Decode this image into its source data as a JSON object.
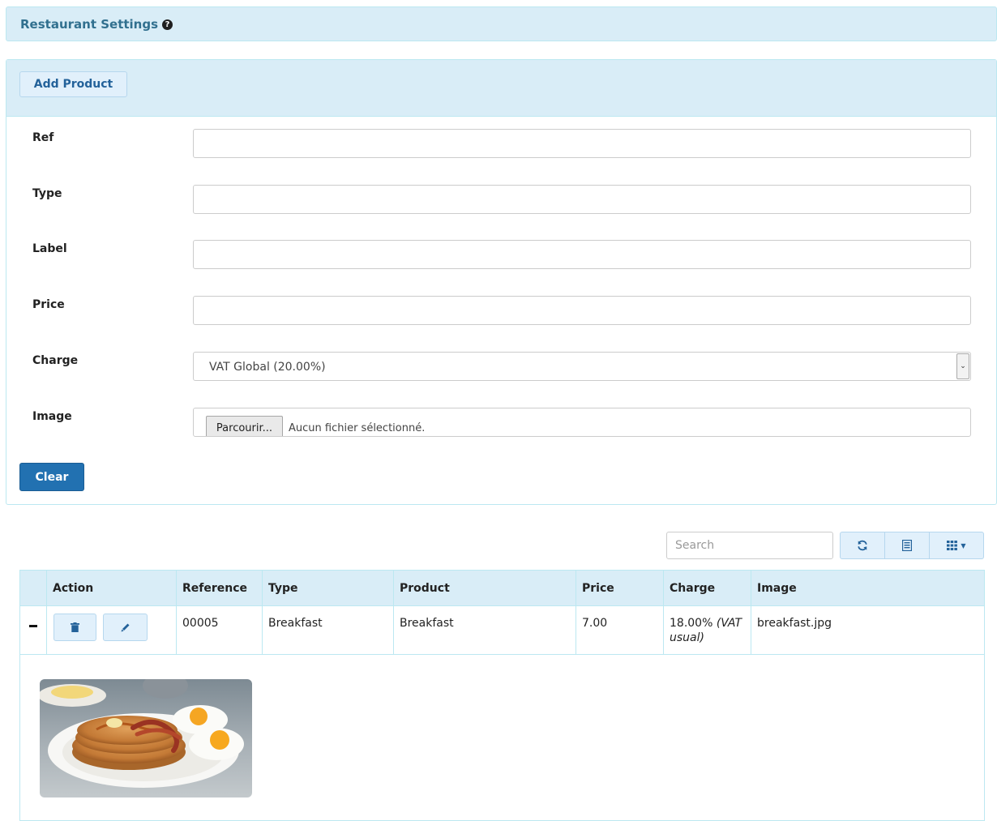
{
  "header": {
    "title": "Restaurant Settings"
  },
  "form": {
    "add_button": "Add Product",
    "fields": {
      "ref": {
        "label": "Ref",
        "value": ""
      },
      "type": {
        "label": "Type",
        "value": ""
      },
      "label": {
        "label": "Label",
        "value": ""
      },
      "price": {
        "label": "Price",
        "value": ""
      },
      "charge": {
        "label": "Charge",
        "selected": "VAT Global (20.00%)"
      },
      "image": {
        "label": "Image",
        "browse_button": "Parcourir...",
        "status": "Aucun fichier sélectionné."
      }
    },
    "clear_button": "Clear"
  },
  "toolbar": {
    "search_placeholder": "Search",
    "icons": [
      "refresh-icon",
      "list-icon",
      "columns-icon"
    ]
  },
  "table": {
    "columns": [
      "Action",
      "Reference",
      "Type",
      "Product",
      "Price",
      "Charge",
      "Image"
    ],
    "rows": [
      {
        "reference": "00005",
        "type": "Breakfast",
        "product": "Breakfast",
        "price": "7.00",
        "charge_rate": "18.00%",
        "charge_name": "(VAT usual)",
        "image": "breakfast.jpg"
      }
    ]
  },
  "colors": {
    "accent": "#d9edf7",
    "primary": "#2271b1",
    "border": "#bce8f1"
  }
}
